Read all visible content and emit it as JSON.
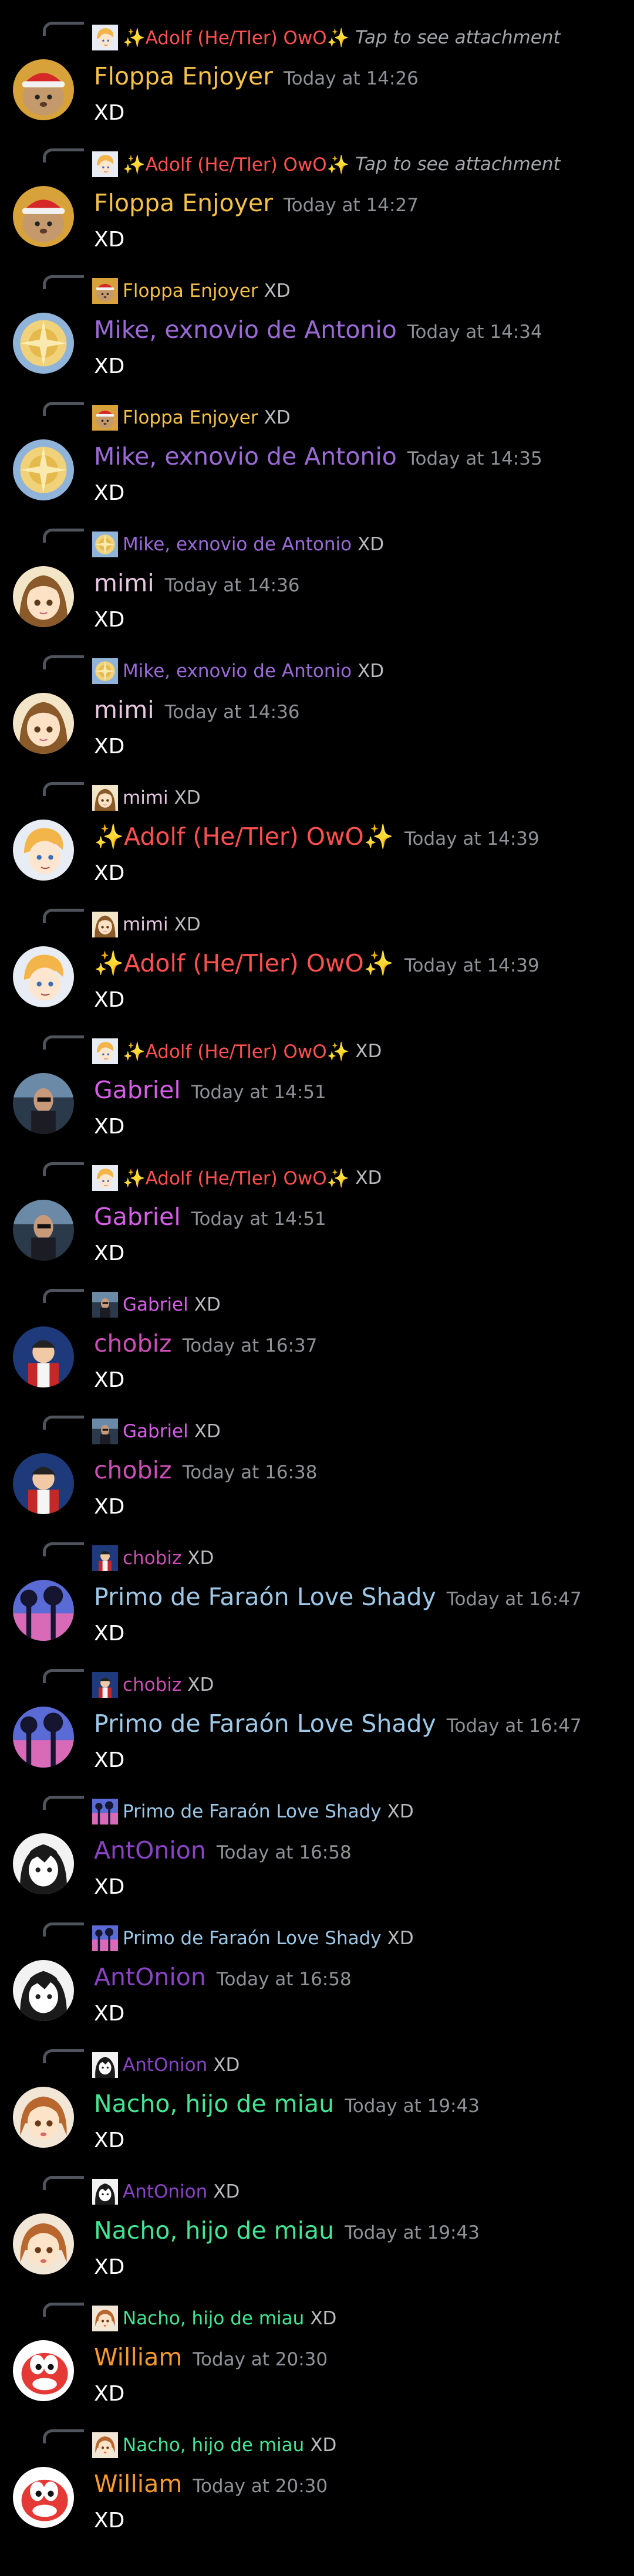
{
  "users": {
    "floppa": {
      "name": "Floppa Enjoyer",
      "color": "#f5c146",
      "avatar": "floppa"
    },
    "mike": {
      "name": "Mike, exnovio de Antonio",
      "color": "#9b6ad6",
      "avatar": "mike"
    },
    "mimi": {
      "name": "mimi",
      "color": "#e7c7e2",
      "avatar": "mimi"
    },
    "adolf": {
      "name": "✨Adolf (He/Tler) OwO✨",
      "color": "#ff5050",
      "avatar": "adolf"
    },
    "gabriel": {
      "name": "Gabriel",
      "color": "#d75fe8",
      "avatar": "gabriel"
    },
    "chobiz": {
      "name": "chobiz",
      "color": "#cc4fb7",
      "avatar": "chobiz"
    },
    "primo": {
      "name": "Primo de Faraón Love Shady",
      "color": "#9ec8e8",
      "avatar": "primo"
    },
    "antonion": {
      "name": "AntOnion",
      "color": "#8a43c4",
      "avatar": "antonion"
    },
    "nacho": {
      "name": "Nacho, hijo de miau",
      "color": "#43e694",
      "avatar": "nacho"
    },
    "william": {
      "name": "William",
      "color": "#f59a2e",
      "avatar": "william"
    }
  },
  "messages": [
    {
      "author": "floppa",
      "time": "Today at 14:26",
      "text": "XD",
      "reply_to": "adolf",
      "reply_text": "Tap to see attachment",
      "reply_italic": true
    },
    {
      "author": "floppa",
      "time": "Today at 14:27",
      "text": "XD",
      "reply_to": "adolf",
      "reply_text": "Tap to see attachment",
      "reply_italic": true
    },
    {
      "author": "mike",
      "time": "Today at 14:34",
      "text": "XD",
      "reply_to": "floppa",
      "reply_text": "XD",
      "reply_italic": false
    },
    {
      "author": "mike",
      "time": "Today at 14:35",
      "text": "XD",
      "reply_to": "floppa",
      "reply_text": "XD",
      "reply_italic": false
    },
    {
      "author": "mimi",
      "time": "Today at 14:36",
      "text": "XD",
      "reply_to": "mike",
      "reply_text": "XD",
      "reply_italic": false
    },
    {
      "author": "mimi",
      "time": "Today at 14:36",
      "text": "XD",
      "reply_to": "mike",
      "reply_text": "XD",
      "reply_italic": false
    },
    {
      "author": "adolf",
      "time": "Today at 14:39",
      "text": "XD",
      "reply_to": "mimi",
      "reply_text": "XD",
      "reply_italic": false
    },
    {
      "author": "adolf",
      "time": "Today at 14:39",
      "text": "XD",
      "reply_to": "mimi",
      "reply_text": "XD",
      "reply_italic": false
    },
    {
      "author": "gabriel",
      "time": "Today at 14:51",
      "text": "XD",
      "reply_to": "adolf",
      "reply_text": "XD",
      "reply_italic": false
    },
    {
      "author": "gabriel",
      "time": "Today at 14:51",
      "text": "XD",
      "reply_to": "adolf",
      "reply_text": "XD",
      "reply_italic": false
    },
    {
      "author": "chobiz",
      "time": "Today at 16:37",
      "text": "XD",
      "reply_to": "gabriel",
      "reply_text": "XD",
      "reply_italic": false
    },
    {
      "author": "chobiz",
      "time": "Today at 16:38",
      "text": "XD",
      "reply_to": "gabriel",
      "reply_text": "XD",
      "reply_italic": false
    },
    {
      "author": "primo",
      "time": "Today at 16:47",
      "text": "XD",
      "reply_to": "chobiz",
      "reply_text": "XD",
      "reply_italic": false
    },
    {
      "author": "primo",
      "time": "Today at 16:47",
      "text": "XD",
      "reply_to": "chobiz",
      "reply_text": "XD",
      "reply_italic": false
    },
    {
      "author": "antonion",
      "time": "Today at 16:58",
      "text": "XD",
      "reply_to": "primo",
      "reply_text": "XD",
      "reply_italic": false
    },
    {
      "author": "antonion",
      "time": "Today at 16:58",
      "text": "XD",
      "reply_to": "primo",
      "reply_text": "XD",
      "reply_italic": false
    },
    {
      "author": "nacho",
      "time": "Today at 19:43",
      "text": "XD",
      "reply_to": "antonion",
      "reply_text": "XD",
      "reply_italic": false
    },
    {
      "author": "nacho",
      "time": "Today at 19:43",
      "text": "XD",
      "reply_to": "antonion",
      "reply_text": "XD",
      "reply_italic": false
    },
    {
      "author": "william",
      "time": "Today at 20:30",
      "text": "XD",
      "reply_to": "nacho",
      "reply_text": "XD",
      "reply_italic": false
    },
    {
      "author": "william",
      "time": "Today at 20:30",
      "text": "XD",
      "reply_to": "nacho",
      "reply_text": "XD",
      "reply_italic": false
    }
  ]
}
